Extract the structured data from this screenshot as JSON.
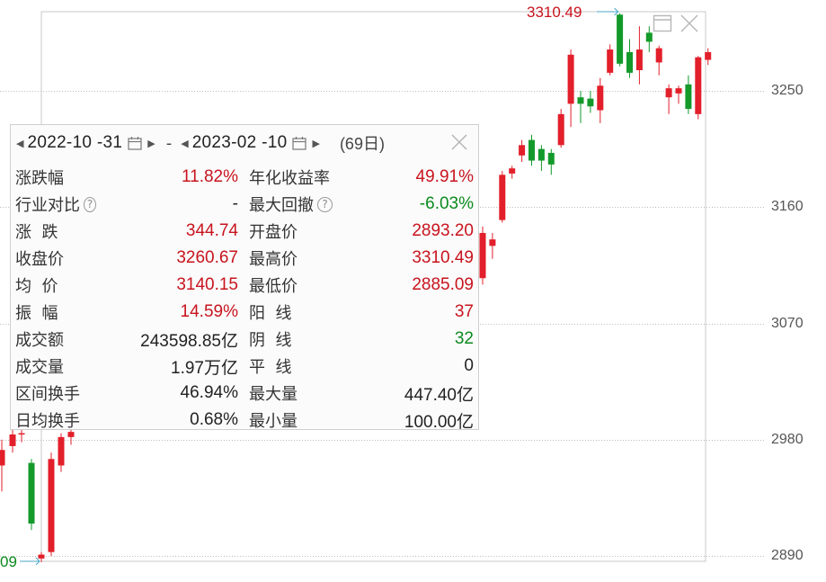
{
  "chart_data": {
    "type": "candlestick",
    "ylim": [
      2870,
      3320
    ],
    "y_ticks": [
      3250,
      3160,
      3070,
      2980,
      2890
    ],
    "grid": "horizontal-dotted",
    "high_label": "3310.49",
    "low_label": "09",
    "series": [
      {
        "o": 2960,
        "c": 2972,
        "h": 2980,
        "l": 2940
      },
      {
        "o": 2975,
        "c": 2984,
        "h": 2990,
        "l": 2970
      },
      {
        "o": 2985,
        "c": 2985,
        "h": 2992,
        "l": 2978
      },
      {
        "o": 2962,
        "c": 2915,
        "h": 2965,
        "l": 2910
      },
      {
        "o": 2888,
        "c": 2891,
        "h": 2893,
        "l": 2885
      },
      {
        "o": 2893,
        "c": 2965,
        "h": 2970,
        "l": 2890
      },
      {
        "o": 2960,
        "c": 2982,
        "h": 2985,
        "l": 2955
      },
      {
        "o": 2982,
        "c": 2986,
        "h": 2990,
        "l": 2976
      },
      {
        "o": 3105,
        "c": 3140,
        "h": 3145,
        "l": 3100
      },
      {
        "o": 3130,
        "c": 3135,
        "h": 3140,
        "l": 3120
      },
      {
        "o": 3150,
        "c": 3185,
        "h": 3188,
        "l": 3148
      },
      {
        "o": 3186,
        "c": 3190,
        "h": 3192,
        "l": 3182
      },
      {
        "o": 3200,
        "c": 3208,
        "h": 3212,
        "l": 3195
      },
      {
        "o": 3212,
        "c": 3196,
        "h": 3216,
        "l": 3192
      },
      {
        "o": 3205,
        "c": 3196,
        "h": 3208,
        "l": 3188
      },
      {
        "o": 3202,
        "c": 3193,
        "h": 3205,
        "l": 3185
      },
      {
        "o": 3208,
        "c": 3232,
        "h": 3236,
        "l": 3206
      },
      {
        "o": 3240,
        "c": 3278,
        "h": 3282,
        "l": 3222
      },
      {
        "o": 3245,
        "c": 3240,
        "h": 3250,
        "l": 3225
      },
      {
        "o": 3244,
        "c": 3238,
        "h": 3250,
        "l": 3233
      },
      {
        "o": 3235,
        "c": 3254,
        "h": 3260,
        "l": 3225
      },
      {
        "o": 3264,
        "c": 3282,
        "h": 3286,
        "l": 3262
      },
      {
        "o": 3309,
        "c": 3271,
        "h": 3310,
        "l": 3269
      },
      {
        "o": 3280,
        "c": 3264,
        "h": 3290,
        "l": 3260
      },
      {
        "o": 3266,
        "c": 3282,
        "h": 3300,
        "l": 3255
      },
      {
        "o": 3295,
        "c": 3288,
        "h": 3300,
        "l": 3280
      },
      {
        "o": 3272,
        "c": 3283,
        "h": 3285,
        "l": 3262
      },
      {
        "o": 3245,
        "c": 3252,
        "h": 3255,
        "l": 3232
      },
      {
        "o": 3248,
        "c": 3252,
        "h": 3254,
        "l": 3240
      },
      {
        "o": 3255,
        "c": 3236,
        "h": 3262,
        "l": 3232
      },
      {
        "o": 3232,
        "c": 3276,
        "h": 3277,
        "l": 3228
      },
      {
        "o": 3274,
        "c": 3280,
        "h": 3283,
        "l": 3270
      }
    ]
  },
  "colors": {
    "up": "#e21f2a",
    "down": "#139a2b",
    "value_red": "#c8141e",
    "value_green": "#0b8a1e"
  },
  "controls": {
    "maximize_icon": "window-icon",
    "close_icon": "close-x-icon"
  },
  "range": {
    "start": "2022-10 -31",
    "end": "2023-02 -10",
    "separator": "-",
    "days": "(69日)"
  },
  "stats": [
    {
      "label": "涨跌幅",
      "value": "11.82%",
      "value_color": "red",
      "label2": "年化收益率",
      "value2": "49.91%",
      "value2_color": "red",
      "help2": false
    },
    {
      "label": "行业对比",
      "value": "-",
      "value_color": "dark",
      "help": true,
      "label2": "最大回撤",
      "value2": "-6.03%",
      "value2_color": "green",
      "help2": true
    },
    {
      "label": "涨  跌",
      "value": "344.74",
      "value_color": "red",
      "label2": "开盘价",
      "value2": "2893.20",
      "value2_color": "red"
    },
    {
      "label": "收盘价",
      "value": "3260.67",
      "value_color": "red",
      "label2": "最高价",
      "value2": "3310.49",
      "value2_color": "red"
    },
    {
      "label": "均  价",
      "value": "3140.15",
      "value_color": "red",
      "label2": "最低价",
      "value2": "2885.09",
      "value2_color": "red"
    },
    {
      "label": "振  幅",
      "value": "14.59%",
      "value_color": "red",
      "label2": "阳  线",
      "value2": "37",
      "value2_color": "red"
    },
    {
      "label": "成交额",
      "value": "243598.85亿",
      "value_color": "dark",
      "label2": "阴  线",
      "value2": "32",
      "value2_color": "green"
    },
    {
      "label": "成交量",
      "value": "1.97万亿",
      "value_color": "dark",
      "label2": "平  线",
      "value2": "0",
      "value2_color": "dark"
    },
    {
      "label": "区间换手",
      "value": "46.94%",
      "value_color": "dark",
      "label2": "最大量",
      "value2": "447.40亿",
      "value2_color": "dark"
    },
    {
      "label": "日均换手",
      "value": "0.68%",
      "value_color": "dark",
      "label2": "最小量",
      "value2": "100.00亿",
      "value2_color": "dark"
    }
  ]
}
